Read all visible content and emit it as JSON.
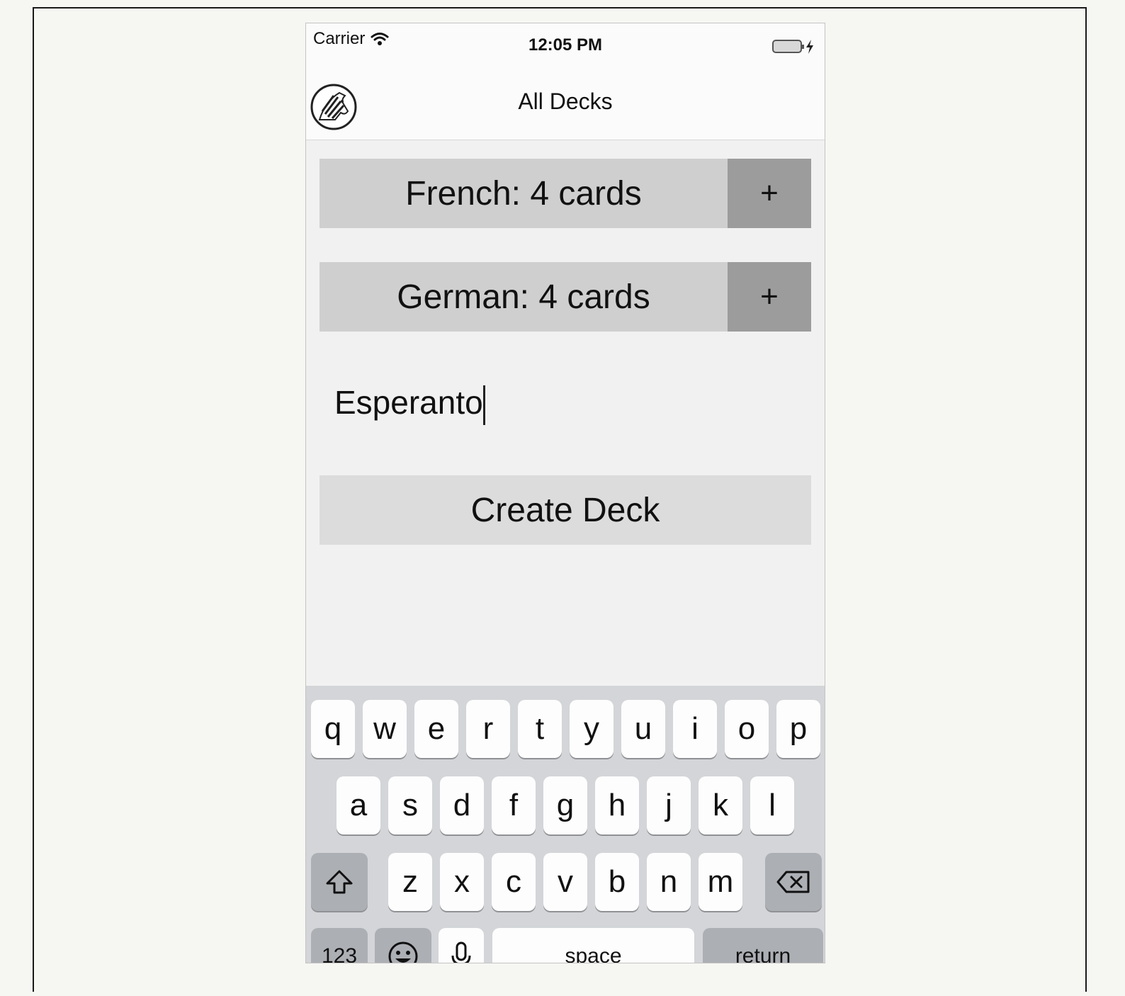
{
  "status_bar": {
    "carrier": "Carrier",
    "time": "12:05 PM"
  },
  "nav": {
    "title": "All Decks",
    "logo_icon": "zebra-logo-icon"
  },
  "decks": [
    {
      "label": "French: 4 cards",
      "add_label": "+"
    },
    {
      "label": "German: 4 cards",
      "add_label": "+"
    }
  ],
  "new_deck": {
    "input_value": "Esperanto",
    "create_label": "Create Deck"
  },
  "keyboard": {
    "row1": [
      "q",
      "w",
      "e",
      "r",
      "t",
      "y",
      "u",
      "i",
      "o",
      "p"
    ],
    "row2": [
      "a",
      "s",
      "d",
      "f",
      "g",
      "h",
      "j",
      "k",
      "l"
    ],
    "row3": [
      "z",
      "x",
      "c",
      "v",
      "b",
      "n",
      "m"
    ],
    "numbers_label": "123",
    "space_label": "space",
    "return_label": "return"
  },
  "colors": {
    "deck_button": "#cfcfcf",
    "deck_add_button": "#9c9c9c",
    "create_button": "#dcdcdc",
    "keyboard_bg": "#d3d5d8"
  }
}
